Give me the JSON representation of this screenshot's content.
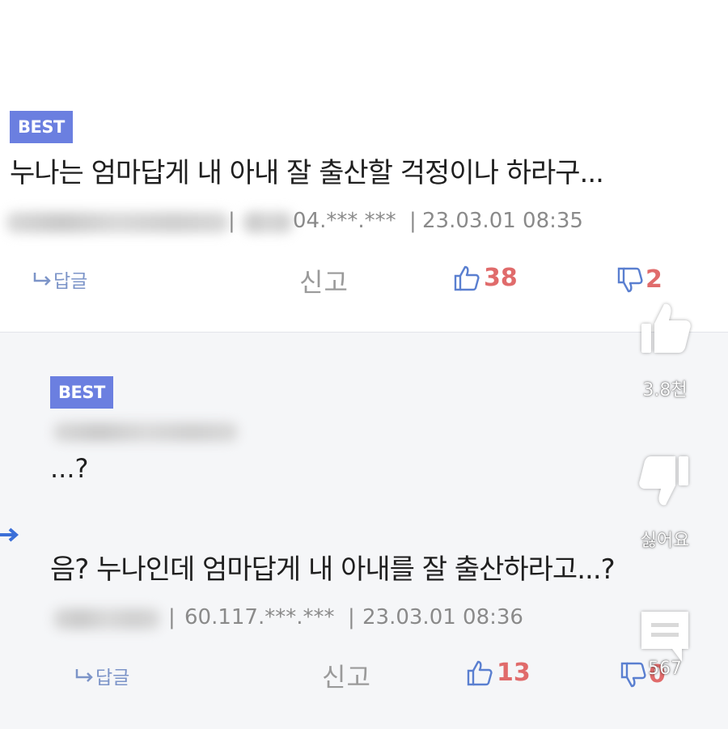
{
  "comment1": {
    "badge": "BEST",
    "text": "누나는 엄마답게 내 아내 잘 출산할 걱정이나 하라구...",
    "ip_visible": "04.***.***",
    "sep": "|",
    "datetime": "23.03.01 08:35",
    "reply_label": "답글",
    "report_label": "신고",
    "likes": "38",
    "dislikes": "2"
  },
  "comment2": {
    "badge": "BEST",
    "ellipsis": "...?",
    "text": "음? 누나인데 엄마답게 내 아내를 잘 출산하라고...?",
    "ip": "60.117.***.***",
    "sep": "|",
    "datetime": "23.03.01 08:36",
    "reply_label": "답글",
    "report_label": "신고",
    "likes": "13",
    "dislikes": "0"
  },
  "overlay": {
    "like_count": "3.8천",
    "dislike_label": "싫어요",
    "comment_count": "567"
  },
  "colors": {
    "badge": "#6b7fe0",
    "like_red": "#e06b6b",
    "reply_blue": "#7c94c8",
    "panel_bg": "#f5f6f8"
  },
  "icons": [
    "thumbs-up-icon",
    "thumbs-down-icon",
    "reply-arrow-icon",
    "comment-icon",
    "arrow-right-icon"
  ]
}
